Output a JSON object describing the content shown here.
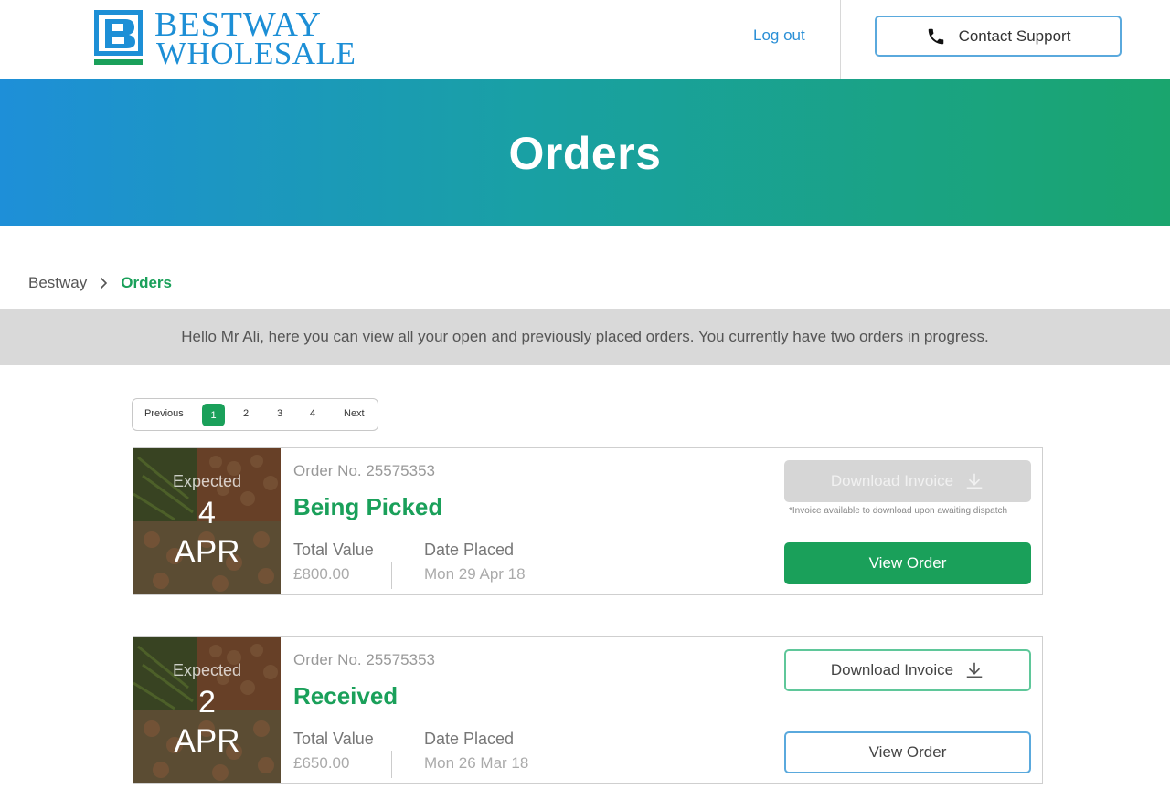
{
  "header": {
    "logo": {
      "line1": "BESTWAY",
      "line2": "WHOLESALE",
      "icon": "bestway-b-logo-icon"
    },
    "logout_label": "Log out",
    "support_label": "Contact Support",
    "support_icon": "phone-icon"
  },
  "banner": {
    "title": "Orders"
  },
  "breadcrumb": {
    "home": "Bestway",
    "current": "Orders",
    "separator_icon": "chevron-right-icon"
  },
  "intro": {
    "text": "Hello Mr Ali, here you can view all your open and previously placed orders. You currently have two orders in progress."
  },
  "pagination": {
    "previous": "Previous",
    "pages": [
      "1",
      "2",
      "3",
      "4"
    ],
    "current": "1",
    "next": "Next"
  },
  "orders": [
    {
      "expected_label": "Expected",
      "expected_day": "4",
      "expected_month": "APR",
      "order_no": "Order No. 25575353",
      "status": "Being Picked",
      "total_label": "Total Value",
      "total_value": "£800.00",
      "date_label": "Date Placed",
      "date_value": "Mon 29 Apr 18",
      "download_label": "Download Invoice",
      "download_enabled": false,
      "invoice_note": "*Invoice available to download upon awaiting dispatch",
      "view_label": "View Order"
    },
    {
      "expected_label": "Expected",
      "expected_day": "2",
      "expected_month": "APR",
      "order_no": "Order No. 25575353",
      "status": "Received",
      "total_label": "Total Value",
      "total_value": "£650.00",
      "date_label": "Date Placed",
      "date_value": "Mon 26 Mar 18",
      "download_label": "Download Invoice",
      "download_enabled": true,
      "view_label": "View Order"
    }
  ],
  "colors": {
    "brand_blue": "#1d8fd6",
    "brand_green": "#1aa05a",
    "banner_start": "#1e8fd8",
    "banner_end": "#1aa56e",
    "intro_bg": "#d9d9d9"
  }
}
